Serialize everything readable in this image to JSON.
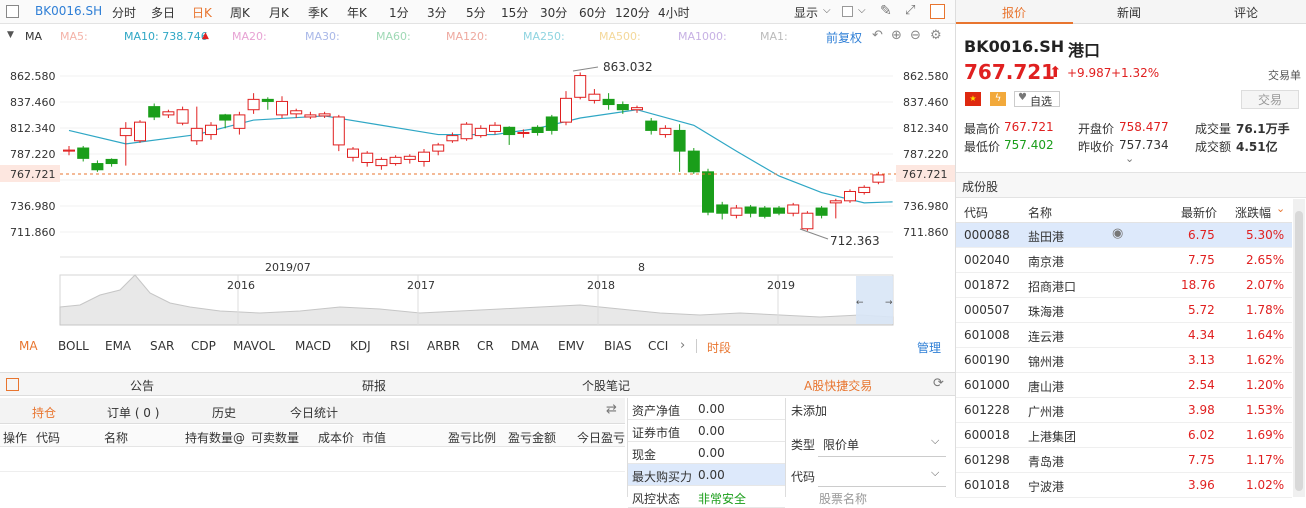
{
  "toolbar": {
    "code": "BK0016.SH",
    "periods": [
      "分时",
      "多日",
      "日K",
      "周K",
      "月K",
      "季K",
      "年K",
      "1分",
      "3分",
      "5分",
      "15分",
      "30分",
      "60分",
      "120分",
      "4小时"
    ],
    "active_period": "日K",
    "display_label": "显示"
  },
  "ma_row": {
    "label": "MA",
    "items": [
      "MA5:",
      "MA10: 738.746",
      "MA20:",
      "MA30:",
      "MA60:",
      "MA120:",
      "MA250:",
      "MA500:",
      "MA1000:",
      "MA1:"
    ],
    "adjust_label": "前复权"
  },
  "chart_data": {
    "type": "candlestick",
    "y_ticks": [
      "862.580",
      "837.460",
      "812.340",
      "787.220",
      "762.100",
      "736.980",
      "711.860"
    ],
    "current_price_label": "767.721",
    "high_annotation": "863.032",
    "low_annotation": "712.363",
    "x_labels": [
      "2019/07",
      "8"
    ],
    "overview_labels": [
      "2016",
      "2017",
      "2018",
      "2019"
    ],
    "ylim": [
      700,
      875
    ],
    "ma10_series_name": "MA10",
    "candles": [
      [
        791,
        790,
        795,
        786
      ],
      [
        783,
        793,
        795,
        780
      ],
      [
        772,
        778,
        781,
        770
      ],
      [
        778,
        782,
        783,
        775
      ],
      [
        812,
        805,
        818,
        776
      ],
      [
        818,
        800,
        820,
        798
      ],
      [
        823,
        833,
        836,
        820
      ],
      [
        828,
        825,
        830,
        822
      ],
      [
        830,
        817,
        833,
        815
      ],
      [
        812,
        800,
        833,
        796
      ],
      [
        815,
        806,
        818,
        801
      ],
      [
        820,
        825,
        826,
        812
      ],
      [
        825,
        812,
        828,
        806
      ],
      [
        840,
        830,
        846,
        826
      ],
      [
        838,
        840,
        842,
        830
      ],
      [
        838,
        825,
        843,
        822
      ],
      [
        829,
        826,
        831,
        822
      ],
      [
        825,
        823,
        828,
        821
      ],
      [
        826,
        824,
        828,
        822
      ],
      [
        823,
        796,
        825,
        790
      ],
      [
        792,
        784,
        794,
        780
      ],
      [
        788,
        779,
        790,
        775
      ],
      [
        782,
        776,
        784,
        772
      ],
      [
        784,
        778,
        786,
        776
      ],
      [
        785,
        782,
        787,
        778
      ],
      [
        789,
        780,
        792,
        775
      ],
      [
        796,
        790,
        798,
        786
      ],
      [
        805,
        800,
        808,
        798
      ],
      [
        816,
        802,
        818,
        800
      ],
      [
        812,
        805,
        815,
        803
      ],
      [
        815,
        809,
        818,
        806
      ],
      [
        806,
        813,
        814,
        796
      ],
      [
        808,
        808,
        811,
        803
      ],
      [
        808,
        813,
        815,
        805
      ],
      [
        810,
        823,
        825,
        806
      ],
      [
        841,
        818,
        848,
        815
      ],
      [
        863,
        842,
        866,
        840
      ],
      [
        845,
        839,
        850,
        836
      ],
      [
        835,
        840,
        846,
        830
      ],
      [
        830,
        835,
        838,
        826
      ],
      [
        832,
        830,
        834,
        827
      ],
      [
        810,
        819,
        822,
        806
      ],
      [
        812,
        806,
        815,
        803
      ],
      [
        790,
        810,
        816,
        770
      ],
      [
        770,
        790,
        793,
        768
      ],
      [
        731,
        770,
        773,
        728
      ],
      [
        730,
        738,
        741,
        724
      ],
      [
        735,
        728,
        738,
        725
      ],
      [
        730,
        736,
        738,
        726
      ],
      [
        727,
        735,
        737,
        725
      ],
      [
        730,
        735,
        737,
        728
      ],
      [
        738,
        730,
        740,
        727
      ],
      [
        730,
        715,
        732,
        713
      ],
      [
        728,
        735,
        737,
        725
      ],
      [
        742,
        740,
        744,
        725
      ],
      [
        751,
        742,
        753,
        740
      ],
      [
        755,
        750,
        757,
        748
      ],
      [
        767,
        760,
        770,
        758
      ]
    ],
    "ma10": [
      [
        0,
        810
      ],
      [
        4,
        797
      ],
      [
        9,
        806
      ],
      [
        13,
        820
      ],
      [
        18,
        824
      ],
      [
        22,
        815
      ],
      [
        26,
        806
      ],
      [
        30,
        806
      ],
      [
        33,
        812
      ],
      [
        36,
        822
      ],
      [
        40,
        830
      ],
      [
        44,
        815
      ],
      [
        47,
        790
      ],
      [
        50,
        766
      ],
      [
        53,
        750
      ],
      [
        56,
        740
      ],
      [
        58,
        741
      ]
    ]
  },
  "indicators": {
    "items": [
      "MA",
      "BOLL",
      "EMA",
      "SAR",
      "CDP",
      "MAVOL",
      "MACD",
      "KDJ",
      "RSI",
      "ARBR",
      "CR",
      "DMA",
      "EMV",
      "BIAS",
      "CCI",
      "时段"
    ],
    "manage_label": "管理"
  },
  "bottom": {
    "tabs": [
      "公告",
      "研报",
      "个股笔记",
      "A股快捷交易"
    ],
    "sub_tabs": [
      "持仓",
      "订单 ( 0 )",
      "历史",
      "今日统计"
    ],
    "columns": [
      "操作",
      "代码",
      "名称",
      "持有数量@",
      "可卖数量",
      "成本价",
      "市值",
      "盈亏比例",
      "盈亏金额",
      "今日盈亏"
    ],
    "account": [
      {
        "k": "资产净值",
        "v": "0.00"
      },
      {
        "k": "证券市值",
        "v": "0.00"
      },
      {
        "k": "现金",
        "v": "0.00"
      },
      {
        "k": "最大购买力",
        "v": "0.00"
      },
      {
        "k": "风控状态",
        "v": "非常安全"
      }
    ],
    "quick": {
      "status": "未添加",
      "type_label": "类型",
      "type_value": "限价单",
      "code_label": "代码",
      "name_placeholder": "股票名称"
    }
  },
  "right": {
    "tabs": [
      "报价",
      "新闻",
      "评论"
    ],
    "code": "BK0016.SH",
    "name": "港口",
    "price": "767.721",
    "arrow": "⬆",
    "change": "+9.987",
    "change_pct": "+1.32%",
    "unit_label": "交易单",
    "watch_label": "自选",
    "trade_btn": "交易",
    "stats": [
      {
        "k": "最高价",
        "v": "767.721",
        "color": "red"
      },
      {
        "k": "开盘价",
        "v": "758.477",
        "color": "red"
      },
      {
        "k": "成交量",
        "v": "76.1万手",
        "color": "dark"
      },
      {
        "k": "最低价",
        "v": "757.402",
        "color": "green"
      },
      {
        "k": "昨收价",
        "v": "757.734",
        "color": "dark"
      },
      {
        "k": "成交额",
        "v": "4.51亿",
        "color": "dark"
      }
    ],
    "components_title": "成份股",
    "table_headers": [
      "代码",
      "名称",
      "最新价",
      "涨跌幅"
    ],
    "rows": [
      {
        "code": "000088",
        "name": "盐田港",
        "price": "6.75",
        "pct": "5.30%"
      },
      {
        "code": "002040",
        "name": "南京港",
        "price": "7.75",
        "pct": "2.65%"
      },
      {
        "code": "001872",
        "name": "招商港口",
        "price": "18.76",
        "pct": "2.07%"
      },
      {
        "code": "000507",
        "name": "珠海港",
        "price": "5.72",
        "pct": "1.78%"
      },
      {
        "code": "601008",
        "name": "连云港",
        "price": "4.34",
        "pct": "1.64%"
      },
      {
        "code": "600190",
        "name": "锦州港",
        "price": "3.13",
        "pct": "1.62%"
      },
      {
        "code": "601000",
        "name": "唐山港",
        "price": "2.54",
        "pct": "1.20%"
      },
      {
        "code": "601228",
        "name": "广州港",
        "price": "3.98",
        "pct": "1.53%"
      },
      {
        "code": "600018",
        "name": "上港集团",
        "price": "6.02",
        "pct": "1.69%"
      },
      {
        "code": "601298",
        "name": "青岛港",
        "price": "7.75",
        "pct": "1.17%"
      },
      {
        "code": "601018",
        "name": "宁波港",
        "price": "3.96",
        "pct": "1.02%"
      }
    ]
  }
}
